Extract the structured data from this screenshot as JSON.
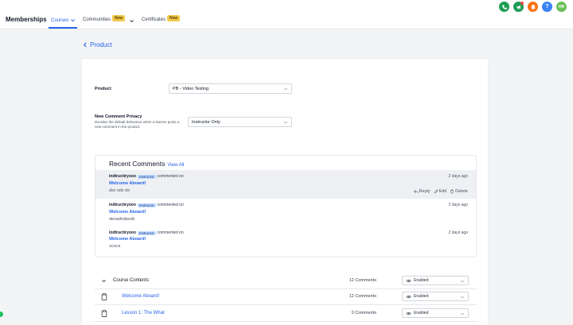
{
  "brand": "Memberships",
  "nav": {
    "courses": "Courses",
    "communities": "Communities",
    "certificates": "Certificates",
    "new_badge": "New"
  },
  "header_icons": {
    "phone": "phone-icon",
    "megaphone": "megaphone-icon",
    "bell": "bell-icon",
    "help": "?",
    "avatar": "HR"
  },
  "colors": {
    "accent": "#2563eb",
    "green": "#1f9d55",
    "orange": "#f97316",
    "help_blue": "#3b82f6",
    "avatar_green": "#6bbf59"
  },
  "back": {
    "label": "Product"
  },
  "settings": {
    "product_label": "Product",
    "product_value": "PB - Video Testing",
    "privacy_label": "New Comment Privacy",
    "privacy_desc": "Decides the default behaviour when a learner posts a new comment in the product",
    "privacy_value": "Instructor Only"
  },
  "recent_comments": {
    "title": "Recent Comments",
    "view_all": "View All",
    "items": [
      {
        "author": "indtructiryooo",
        "tag": "Instructor",
        "verb": "commented on",
        "post": "Welcome Aboard!",
        "body": "dsv sdv ds",
        "time": "2 days ago"
      },
      {
        "author": "indtructiryooo",
        "tag": "Instructor",
        "verb": "commented on",
        "post": "Welcome Aboard!",
        "body": "devadvdavds",
        "time": "2 days ago"
      },
      {
        "author": "indtructiryooo",
        "tag": "Instructor",
        "verb": "commented on",
        "post": "Welcome Aboard!",
        "body": "scsca",
        "time": "2 days ago"
      }
    ],
    "actions": {
      "reply": "Reply",
      "edit": "Edit",
      "delete": "Delete"
    }
  },
  "contents": {
    "header": {
      "title": "Course Contents",
      "comments": "12 Comments",
      "status": "Enabled"
    },
    "rows": [
      {
        "title": "Welcome Aboard!",
        "comments": "12 Comments",
        "status": "Enabled"
      },
      {
        "title": "Lesson 1: The What",
        "comments": "0 Comments",
        "status": "Enabled"
      }
    ]
  }
}
